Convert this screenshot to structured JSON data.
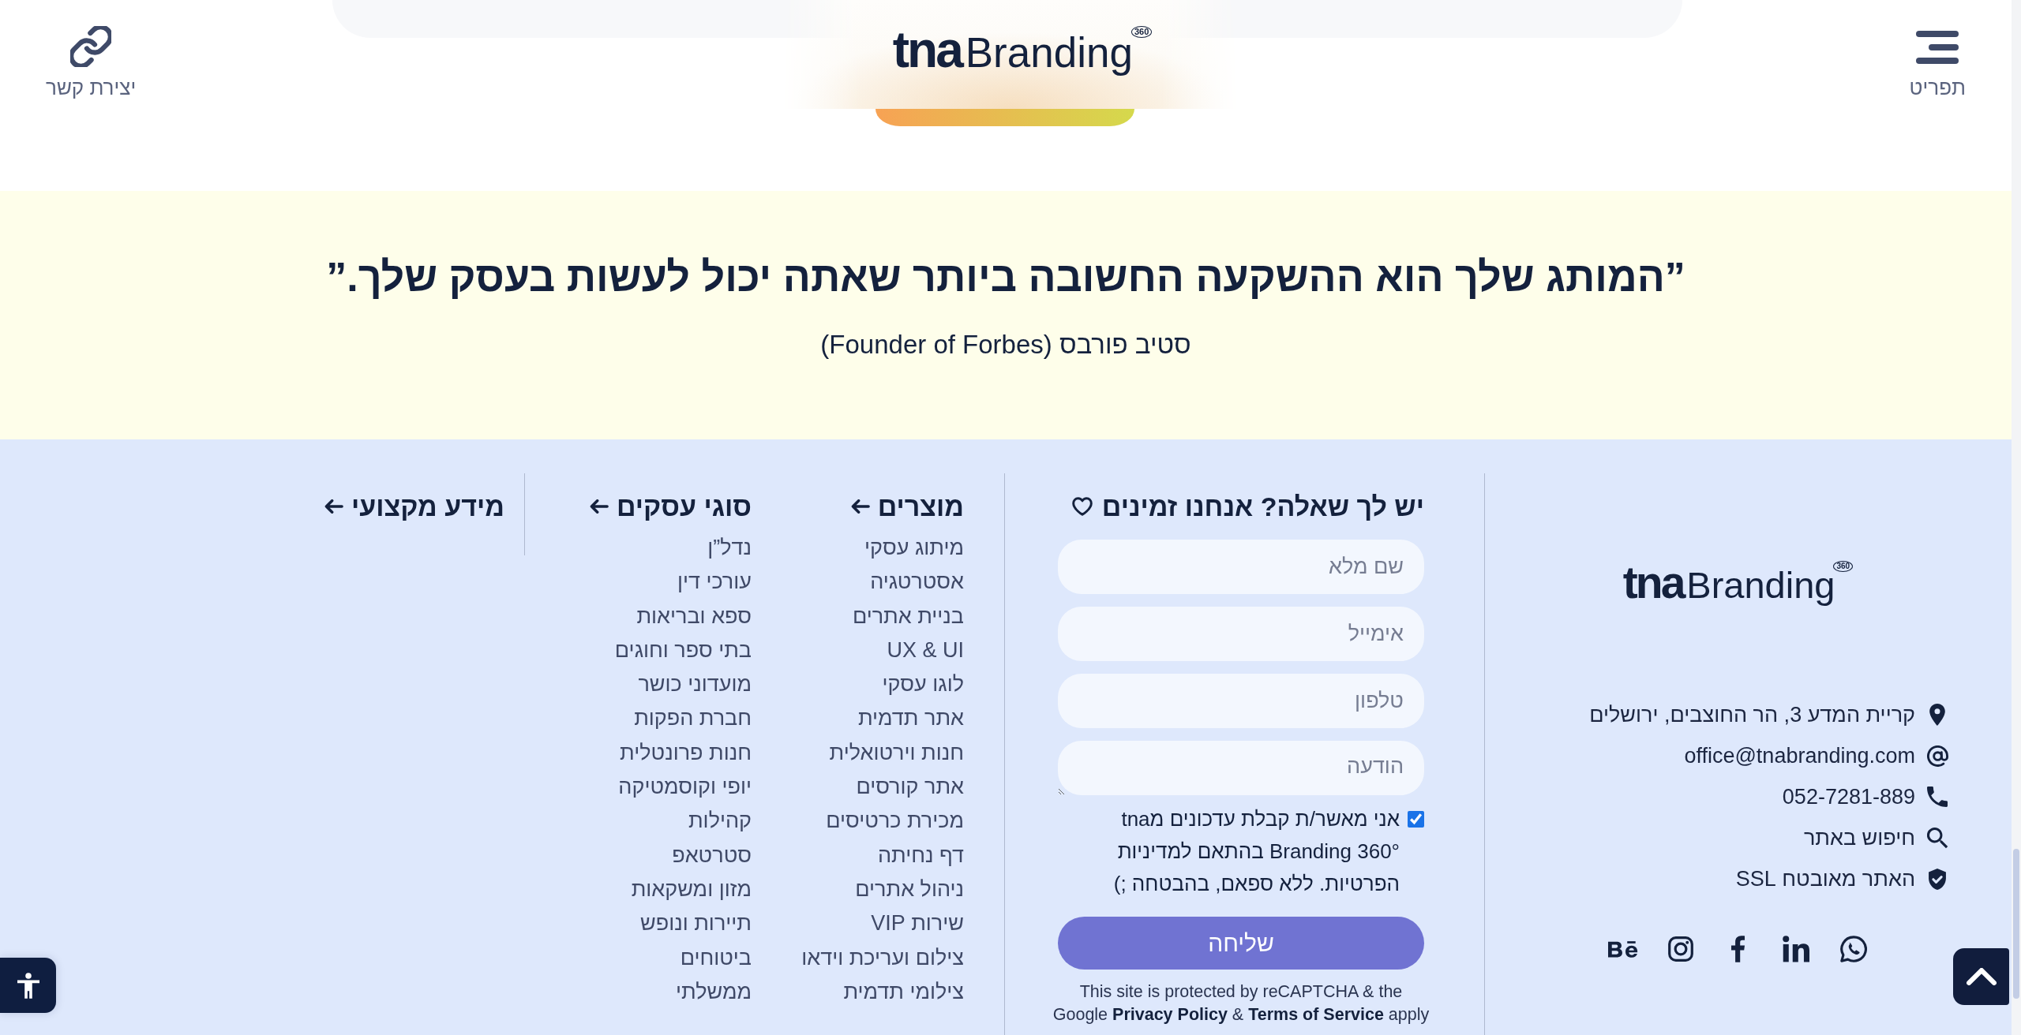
{
  "header": {
    "menu_button": {
      "label": "תפריט"
    },
    "logo": {
      "mark": "tna",
      "name": "Branding",
      "badge": "360"
    },
    "contact_link": {
      "label": "יצירת קשר"
    }
  },
  "quote": {
    "text": "”המותג שלך הוא ההשקעה החשובה ביותר שאתה יכול לעשות בעסק שלך.”",
    "author": "סטיב פורבס (Founder of Forbes)"
  },
  "footer": {
    "contact": {
      "logo": {
        "mark": "tna",
        "name": "Branding",
        "badge": "360"
      },
      "items": [
        {
          "kind": "address",
          "text": "קריית המדע 3, הר החוצבים, ירושלים"
        },
        {
          "kind": "email",
          "text": "office@tnabranding.com"
        },
        {
          "kind": "phone",
          "text": "052-7281-889"
        },
        {
          "kind": "search",
          "text": "חיפוש באתר"
        },
        {
          "kind": "secure",
          "text": "האתר מאובטח SSL"
        }
      ],
      "social": [
        {
          "kind": "whatsapp"
        },
        {
          "kind": "linkedin"
        },
        {
          "kind": "facebook"
        },
        {
          "kind": "instagram"
        },
        {
          "kind": "behance"
        }
      ]
    },
    "form": {
      "title": "יש לך שאלה? אנחנו זמינים",
      "fields": [
        {
          "kind": "input",
          "placeholder": "שם מלא"
        },
        {
          "kind": "input",
          "placeholder": "אימייל"
        },
        {
          "kind": "input",
          "placeholder": "טלפון"
        },
        {
          "kind": "textarea",
          "placeholder": "הודעה"
        }
      ],
      "consent": {
        "checked": true,
        "text": "אני מאשר/ת קבלת עדכונים מtna Branding 360°‎ בהתאם למדיניות הפרטיות. ללא ספאם, בהבטחה ;)"
      },
      "submit": "שליחה",
      "recaptcha_note": "This site is protected by reCAPTCHA & the Google **Privacy Policy** & **Terms of Service** apply"
    },
    "link_columns": [
      {
        "title": "מוצרים",
        "items": [
          "מיתוג עסקי",
          "אסטרטגיה",
          "בניית אתרים",
          "UX & UI",
          "לוגו עסקי",
          "אתר תדמית",
          "חנות וירטואלית",
          "אתר קורסים",
          "מכירת כרטיסים",
          "דף נחיתה",
          "ניהול אתרים",
          "שירות VIP",
          "צילום ועריכת וידאו",
          "צילומי תדמית"
        ]
      },
      {
        "title": "סוגי עסקים",
        "items": [
          "נדל”ן",
          "עורכי דין",
          "ספא ובריאות",
          "בתי ספר וחוגים",
          "מועדוני כושר",
          "חברת הפקות",
          "חנות פרונטלית",
          "יופי וקוסמטיקה",
          "קהילות",
          "סטרטאפ",
          "מזון ומשקאות",
          "תיירות ונופש",
          "ביטוחים",
          "ממשלתי"
        ]
      },
      {
        "title": "מידע מקצועי"
      }
    ]
  },
  "floating_buttons": [
    {
      "kind": "accessibility"
    },
    {
      "kind": "scroll_top"
    }
  ]
}
